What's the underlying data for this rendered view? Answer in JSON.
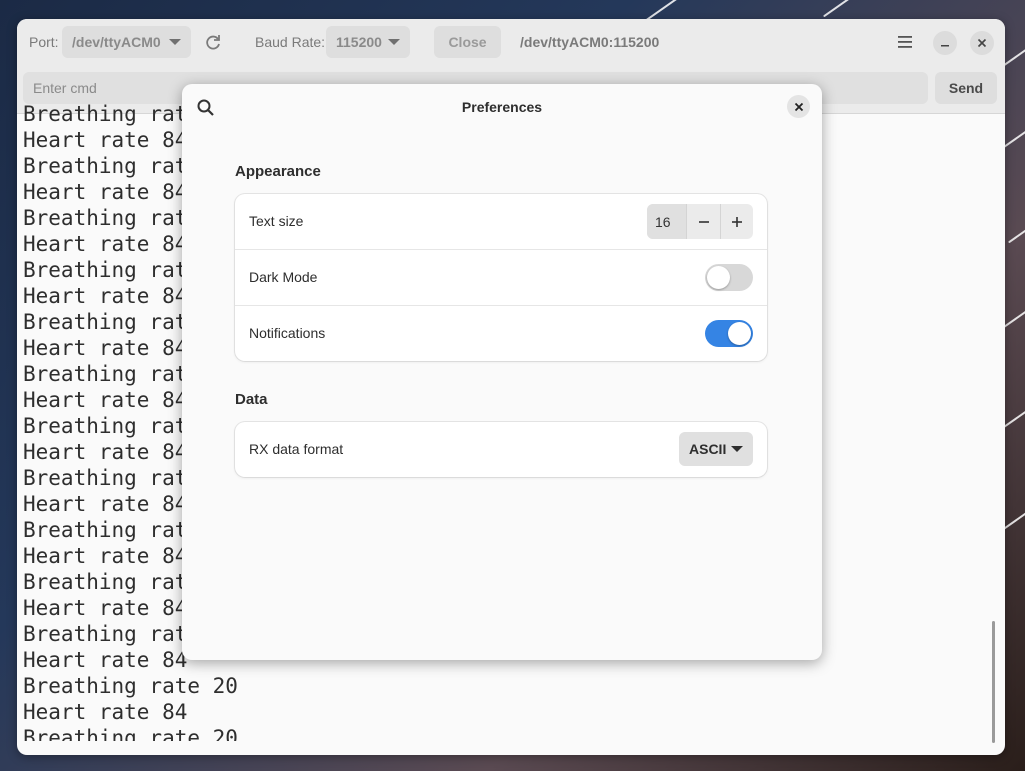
{
  "header": {
    "port_label": "Port:",
    "port_value": "/dev/ttyACM0",
    "baud_label": "Baud Rate:",
    "baud_value": "115200",
    "close_label": "Close",
    "connection_status": "/dev/ttyACM0:115200",
    "icons": [
      "refresh-icon",
      "menu-icon",
      "minimize-icon",
      "close-icon"
    ]
  },
  "command": {
    "placeholder": "Enter cmd",
    "send_label": "Send"
  },
  "terminal": {
    "lines": [
      "Breathing rate 20",
      "Heart rate 84",
      "Breathing rate 20",
      "Heart rate 84",
      "Breathing rate 20",
      "Heart rate 84",
      "Breathing rate 20",
      "Heart rate 84",
      "Breathing rate 20",
      "Heart rate 84",
      "Breathing rate 20",
      "Heart rate 84",
      "Breathing rate 20",
      "Heart rate 84",
      "Breathing rate 20",
      "Heart rate 84",
      "Breathing rate 20",
      "Heart rate 84",
      "Breathing rate 20",
      "Heart rate 84",
      "Breathing rate 20",
      "Heart rate 84",
      "Breathing rate 20",
      "Heart rate 84",
      "Breathing rate 20"
    ]
  },
  "preferences": {
    "title": "Preferences",
    "appearance_title": "Appearance",
    "text_size_label": "Text size",
    "text_size_value": "16",
    "dark_mode_label": "Dark Mode",
    "dark_mode_on": false,
    "notifications_label": "Notifications",
    "notifications_on": true,
    "data_title": "Data",
    "rx_format_label": "RX data format",
    "rx_format_value": "ASCII"
  },
  "colors": {
    "accent": "#3584e4",
    "toggle_off": "#d8d8d8"
  }
}
